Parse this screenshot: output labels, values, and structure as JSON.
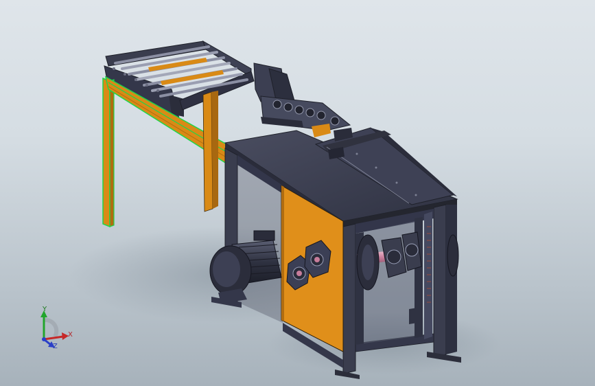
{
  "viewport": {
    "background_top": "#dfe5ea",
    "background_bottom": "#a7b2bb"
  },
  "model": {
    "frame_color": "#3a3d4e",
    "guard_color": "#d98a16",
    "accent_green": "#1fd64a",
    "shaft_color": "#d08aa6"
  },
  "triad": {
    "x_label": "X",
    "y_label": "Y",
    "z_label": "Z",
    "x_color": "#c62828",
    "y_color": "#22a52c",
    "z_color": "#2a3fc8"
  }
}
